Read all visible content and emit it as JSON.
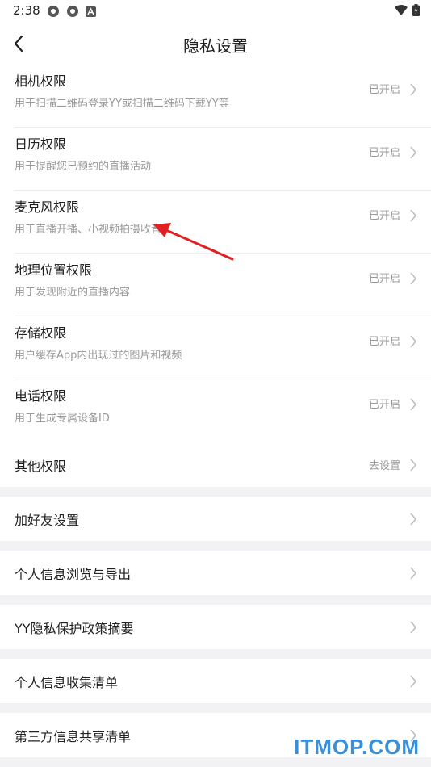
{
  "status_bar": {
    "time": "2:38"
  },
  "header": {
    "title": "隐私设置"
  },
  "permissions": [
    {
      "title": "相机权限",
      "desc": "用于扫描二维码登录YY或扫描二维码下载YY等",
      "status": "已开启"
    },
    {
      "title": "日历权限",
      "desc": "用于提醒您已预约的直播活动",
      "status": "已开启"
    },
    {
      "title": "麦克风权限",
      "desc": "用于直播开播、小视频拍摄收音",
      "status": "已开启"
    },
    {
      "title": "地理位置权限",
      "desc": "用于发现附近的直播内容",
      "status": "已开启"
    },
    {
      "title": "存储权限",
      "desc": "用户缓存App内出现过的图片和视频",
      "status": "已开启"
    },
    {
      "title": "电话权限",
      "desc": "用于生成专属设备ID",
      "status": "已开启"
    }
  ],
  "other_permissions": {
    "title": "其他权限",
    "status": "去设置"
  },
  "menu": [
    {
      "title": "加好友设置"
    },
    {
      "title": "个人信息浏览与导出"
    },
    {
      "title": "YY隐私保护政策摘要"
    },
    {
      "title": "个人信息收集清单"
    },
    {
      "title": "第三方信息共享清单"
    }
  ],
  "watermark": "ITMOP.COM",
  "colors": {
    "arrow": "#e02020",
    "watermark": "#3a8fd9"
  }
}
